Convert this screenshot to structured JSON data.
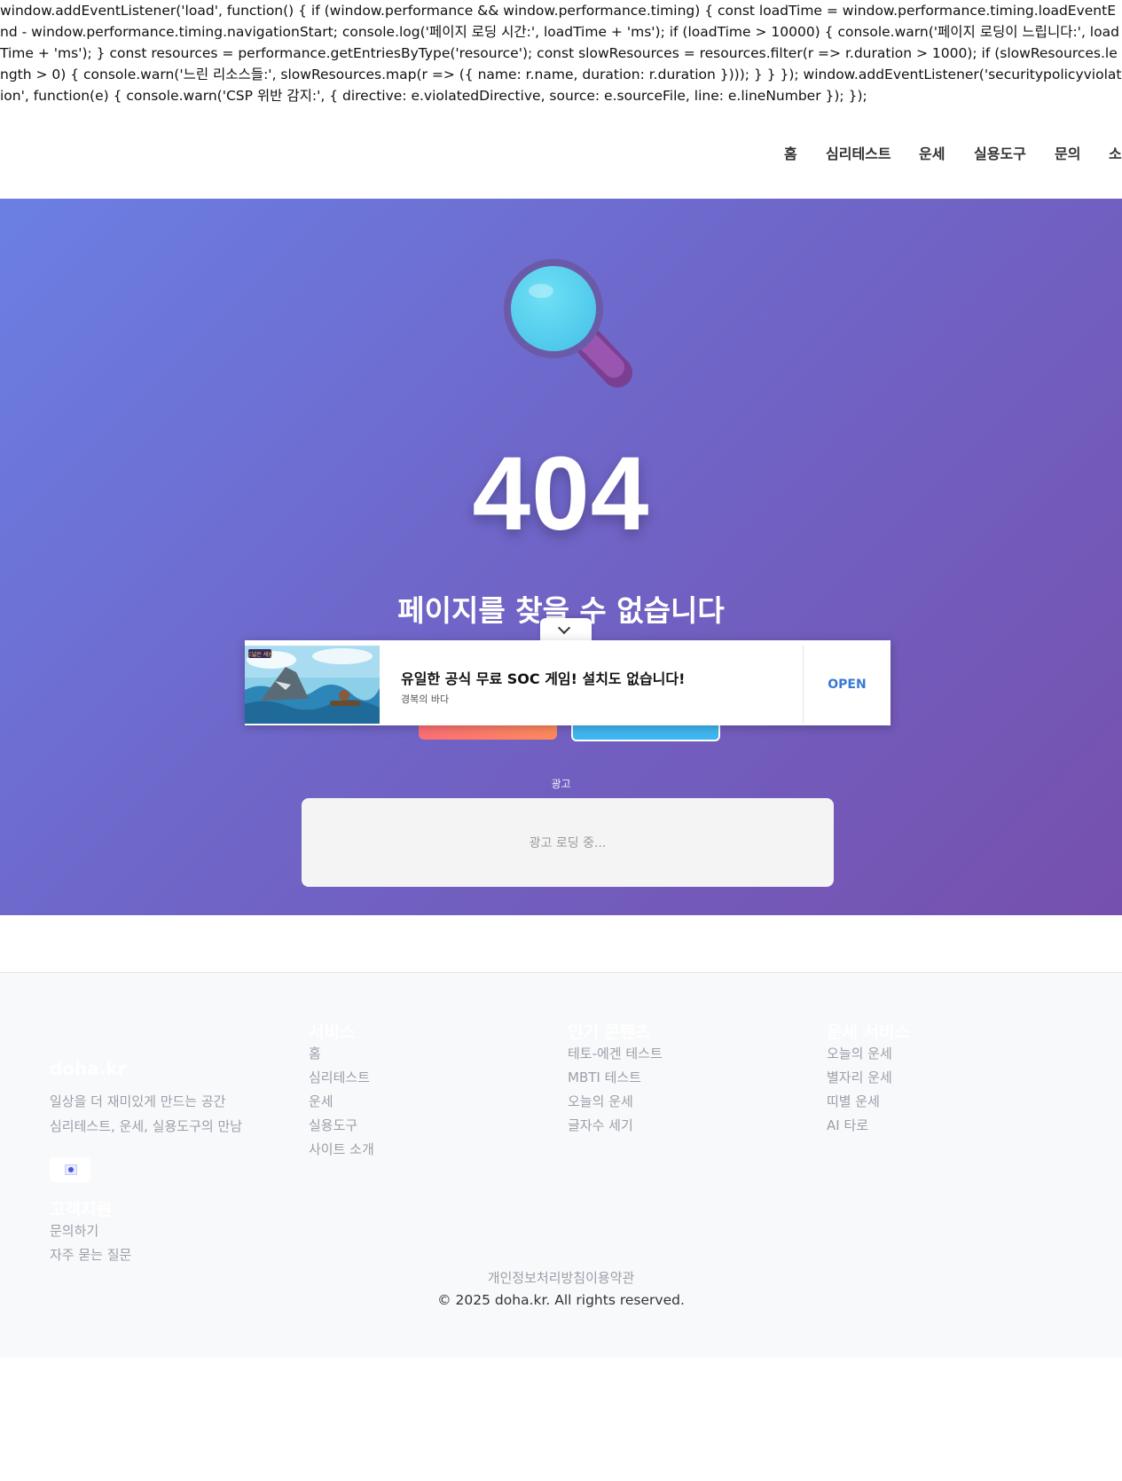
{
  "leaked_script_text": "window.addEventListener('load', function() { if (window.performance && window.performance.timing) { const loadTime = window.performance.timing.loadEventEnd - window.performance.timing.navigationStart; console.log('페이지 로딩 시간:', loadTime + 'ms'); if (loadTime > 10000) { console.warn('페이지 로딩이 느립니다:', loadTime + 'ms'); } const resources = performance.getEntriesByType('resource'); const slowResources = resources.filter(r => r.duration > 1000); if (slowResources.length > 0) { console.warn('느린 리소스들:', slowResources.map(r => ({ name: r.name, duration: r.duration }))); } } }); window.addEventListener('securitypolicyviolation', function(e) { console.warn('CSP 위반 감지:', { directive: e.violatedDirective, source: e.sourceFile, line: e.lineNumber }); });",
  "nav": {
    "items": [
      "홈",
      "심리테스트",
      "운세",
      "실용도구",
      "문의",
      "소"
    ]
  },
  "hero": {
    "error_code": "404",
    "title": "페이지를 찾을 수 없습니다",
    "icon": "magnifier-icon",
    "colors": {
      "gradient_start": "#6b7fe3",
      "gradient_end": "#7650ad"
    }
  },
  "ad_slot": {
    "caption": "광고",
    "loading_text": "광고 로딩 중..."
  },
  "banner_ad": {
    "headline": "유일한 공식 무료 SOC 게임! 설치도 없습니다!",
    "subtitle": "경복의 바다",
    "cta": "OPEN",
    "cta_color": "#3a78d8",
    "image_text": "드넓은 세상"
  },
  "footer": {
    "brand": "doha.kr",
    "tagline": [
      "일상을 더 재미있게 만드는 공간",
      "심리테스트, 운세, 실용도구의 만남"
    ],
    "columns": [
      {
        "heading": "서비스",
        "links": [
          "홈",
          "심리테스트",
          "운세",
          "실용도구",
          "사이트 소개"
        ]
      },
      {
        "heading": "인기 콘텐츠",
        "links": [
          "테토-에겐 테스트",
          "MBTI 테스트",
          "오늘의 운세",
          "글자수 세기"
        ]
      },
      {
        "heading": "운세 서비스",
        "links": [
          "오늘의 운세",
          "별자리 운세",
          "띠별 운세",
          "AI 타로"
        ]
      }
    ],
    "support": {
      "heading": "고객지원",
      "links": [
        "문의하기",
        "자주 묻는 질문"
      ]
    },
    "policy": "개인정보처리방침이용약관",
    "copyright": "© 2025 doha.kr. All rights reserved."
  }
}
